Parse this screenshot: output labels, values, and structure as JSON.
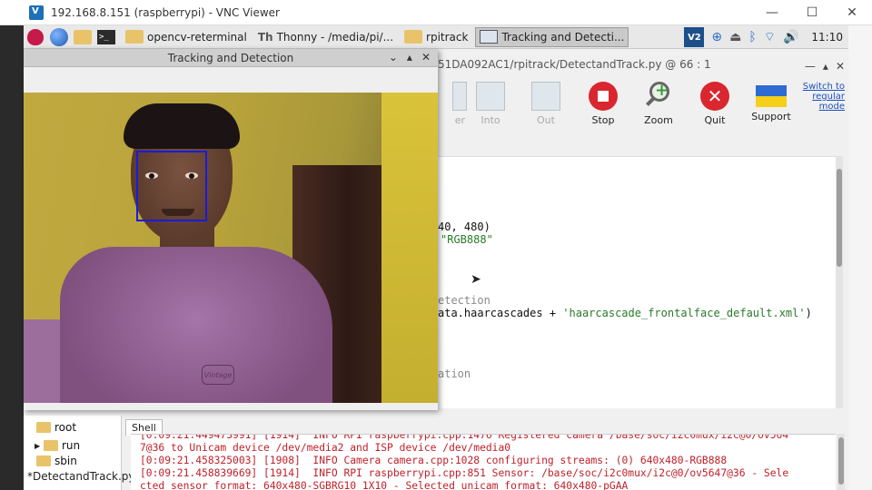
{
  "vnc": {
    "title": "192.168.8.151 (raspberrypi) - VNC Viewer",
    "minimize": "—",
    "maximize": "☐",
    "close": "✕"
  },
  "taskbar": {
    "tasks": [
      {
        "label": "opencv-reterminal",
        "icon": "folder-icon"
      },
      {
        "label": "Thonny  -  /media/pi/...",
        "icon": "thonny-icon"
      },
      {
        "label": "rpitrack",
        "icon": "folder-icon"
      },
      {
        "label": "Tracking and Detecti...",
        "icon": "window-icon",
        "active": true
      }
    ],
    "tray_ve": "V2",
    "clock": "11:10"
  },
  "thonny": {
    "title": "51DA092AC1/rpitrack/DetectandTrack.py  @  66 : 1",
    "toolbar": [
      {
        "label": "er",
        "enabled": false
      },
      {
        "label": "Into",
        "enabled": false
      },
      {
        "label": "Out",
        "enabled": false
      },
      {
        "label": "Stop",
        "enabled": true
      },
      {
        "label": "Zoom",
        "enabled": true
      },
      {
        "label": "Quit",
        "enabled": true
      },
      {
        "label": "Support",
        "enabled": true
      }
    ],
    "switch_link": "Switch to regular mode",
    "code": {
      "line1a": "40, 480)",
      "line2": "\"RGB888\"",
      "line3": "etection",
      "line4a": "ata.haarcascades + ",
      "line4b": "'haarcascade_frontalface_default.xml'",
      "line4c": ")",
      "line5": "ation"
    },
    "files": [
      {
        "name": "root",
        "expandable": false
      },
      {
        "name": "run",
        "expandable": true
      },
      {
        "name": "sbin",
        "expandable": false
      }
    ],
    "file_tab": "*DetectandTrack.py",
    "shell_tab": "Shell",
    "shell_lines": [
      "[0:09:21.449473991] [1914]  INFO RPI raspberrypi.cpp:1476 Registered camera /base/soc/i2c0mux/i2c@0/ov564",
      "7@36 to Unicam device /dev/media2 and ISP device /dev/media0",
      "[0:09:21.458325003] [1908]  INFO Camera camera.cpp:1028 configuring streams: (0) 640x480-RGB888",
      "[0:09:21.458839669] [1914]  INFO RPI raspberrypi.cpp:851 Sensor: /base/soc/i2c0mux/i2c@0/ov5647@36 - Sele",
      "cted sensor format: 640x480-SGBRG10_1X10 - Selected unicam format: 640x480-pGAA"
    ]
  },
  "cv_window": {
    "title": "Tracking and Detection",
    "ctrl_min": "⌄",
    "ctrl_max": "▴",
    "ctrl_close": "✕",
    "shirt_print": "Vintage"
  },
  "colors": {
    "face_box": "#1a1ae0",
    "shell_text": "#c0202a",
    "string_literal": "#2a7a2a"
  }
}
